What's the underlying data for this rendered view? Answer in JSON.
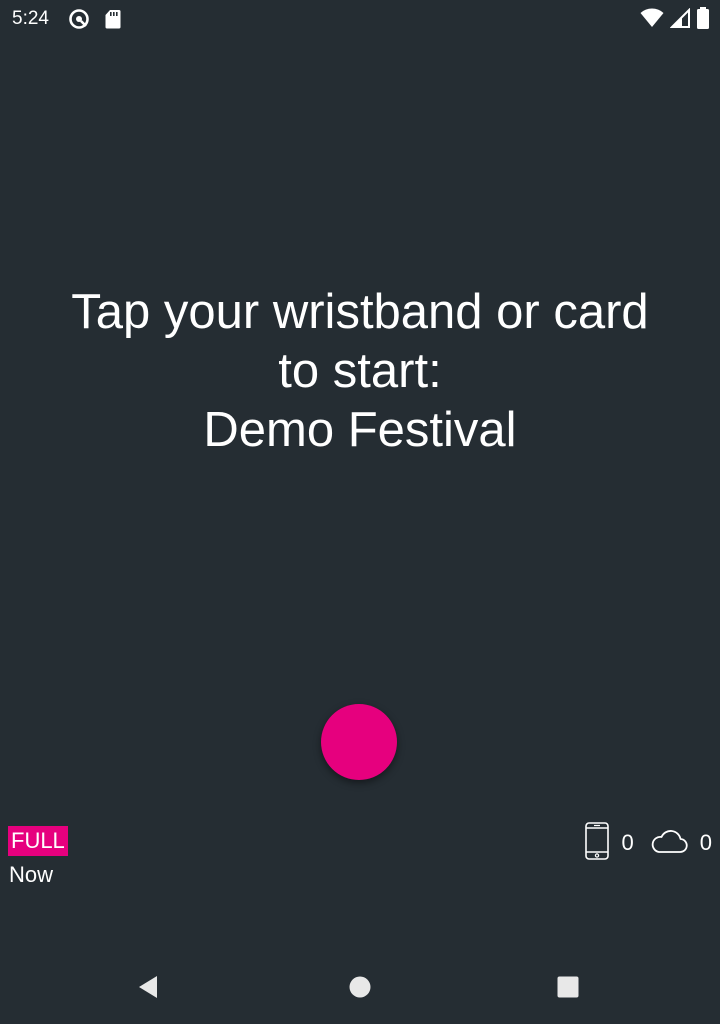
{
  "status_bar": {
    "time": "5:24",
    "left_icons": [
      "vpn-key-circle-icon",
      "sd-card-icon"
    ],
    "right_icons": [
      "wifi-icon",
      "cell-signal-icon",
      "battery-icon"
    ]
  },
  "prompt": {
    "line1": "Tap your wristband or card",
    "line2": "to start:",
    "event_name": "Demo Festival"
  },
  "tap_button": {
    "color": "#e6007e"
  },
  "mode": {
    "badge": "FULL",
    "time": "Now",
    "badge_color": "#e6007e"
  },
  "counters": {
    "device_icon": "phone-icon",
    "device_count": "0",
    "cloud_icon": "cloud-icon",
    "cloud_count": "0"
  },
  "nav_bar": {
    "icons": [
      "back-icon",
      "home-icon",
      "recents-icon"
    ]
  },
  "colors": {
    "background": "#252d33",
    "accent": "#e6007e",
    "text": "#ffffff"
  }
}
